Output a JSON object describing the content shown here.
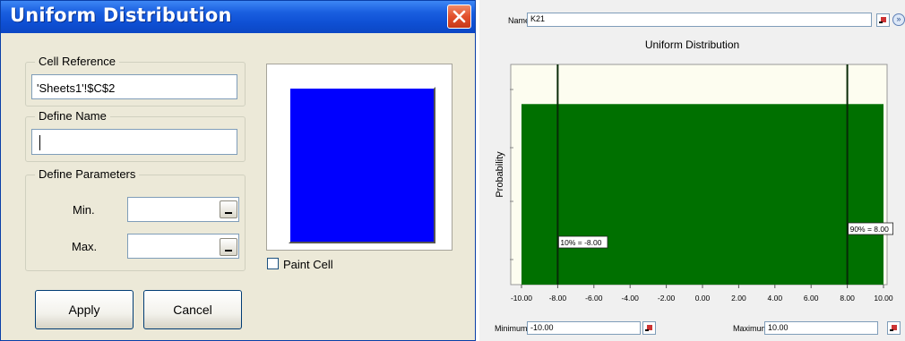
{
  "dialog": {
    "title": "Uniform Distribution",
    "cell_reference": {
      "label": "Cell Reference",
      "value": "'Sheets1'!$C$2"
    },
    "define_name": {
      "label": "Define Name",
      "value": ""
    },
    "define_parameters": {
      "label": "Define Parameters",
      "min_label": "Min.",
      "min_value": "",
      "max_label": "Max.",
      "max_value": ""
    },
    "paint_cell_label": "Paint Cell",
    "paint_cell_checked": false,
    "preview_color": "#0000ff",
    "apply_label": "Apply",
    "cancel_label": "Cancel"
  },
  "panel": {
    "name_label": "Name:",
    "name_value": "K21",
    "minimum_label": "Minimum",
    "minimum_value": "-10.00",
    "maximum_label": "Maximum",
    "maximum_value": "10.00"
  },
  "chart_data": {
    "type": "area",
    "title": "Uniform Distribution",
    "xlabel": "",
    "ylabel": "Probability",
    "xlim": [
      -10,
      10
    ],
    "x_ticks": [
      "-10.00",
      "-8.00",
      "-6.00",
      "-4.00",
      "-2.00",
      "0.00",
      "2.00",
      "4.00",
      "6.00",
      "8.00",
      "10.00"
    ],
    "x": [
      -10,
      10
    ],
    "density_fraction_of_axis": 0.82,
    "fill_color": "#007000",
    "plot_bg": "#fdfdf0",
    "markers": [
      {
        "x": -8,
        "label": "10% = -8.00"
      },
      {
        "x": 8,
        "label": "90% = 8.00"
      }
    ]
  }
}
